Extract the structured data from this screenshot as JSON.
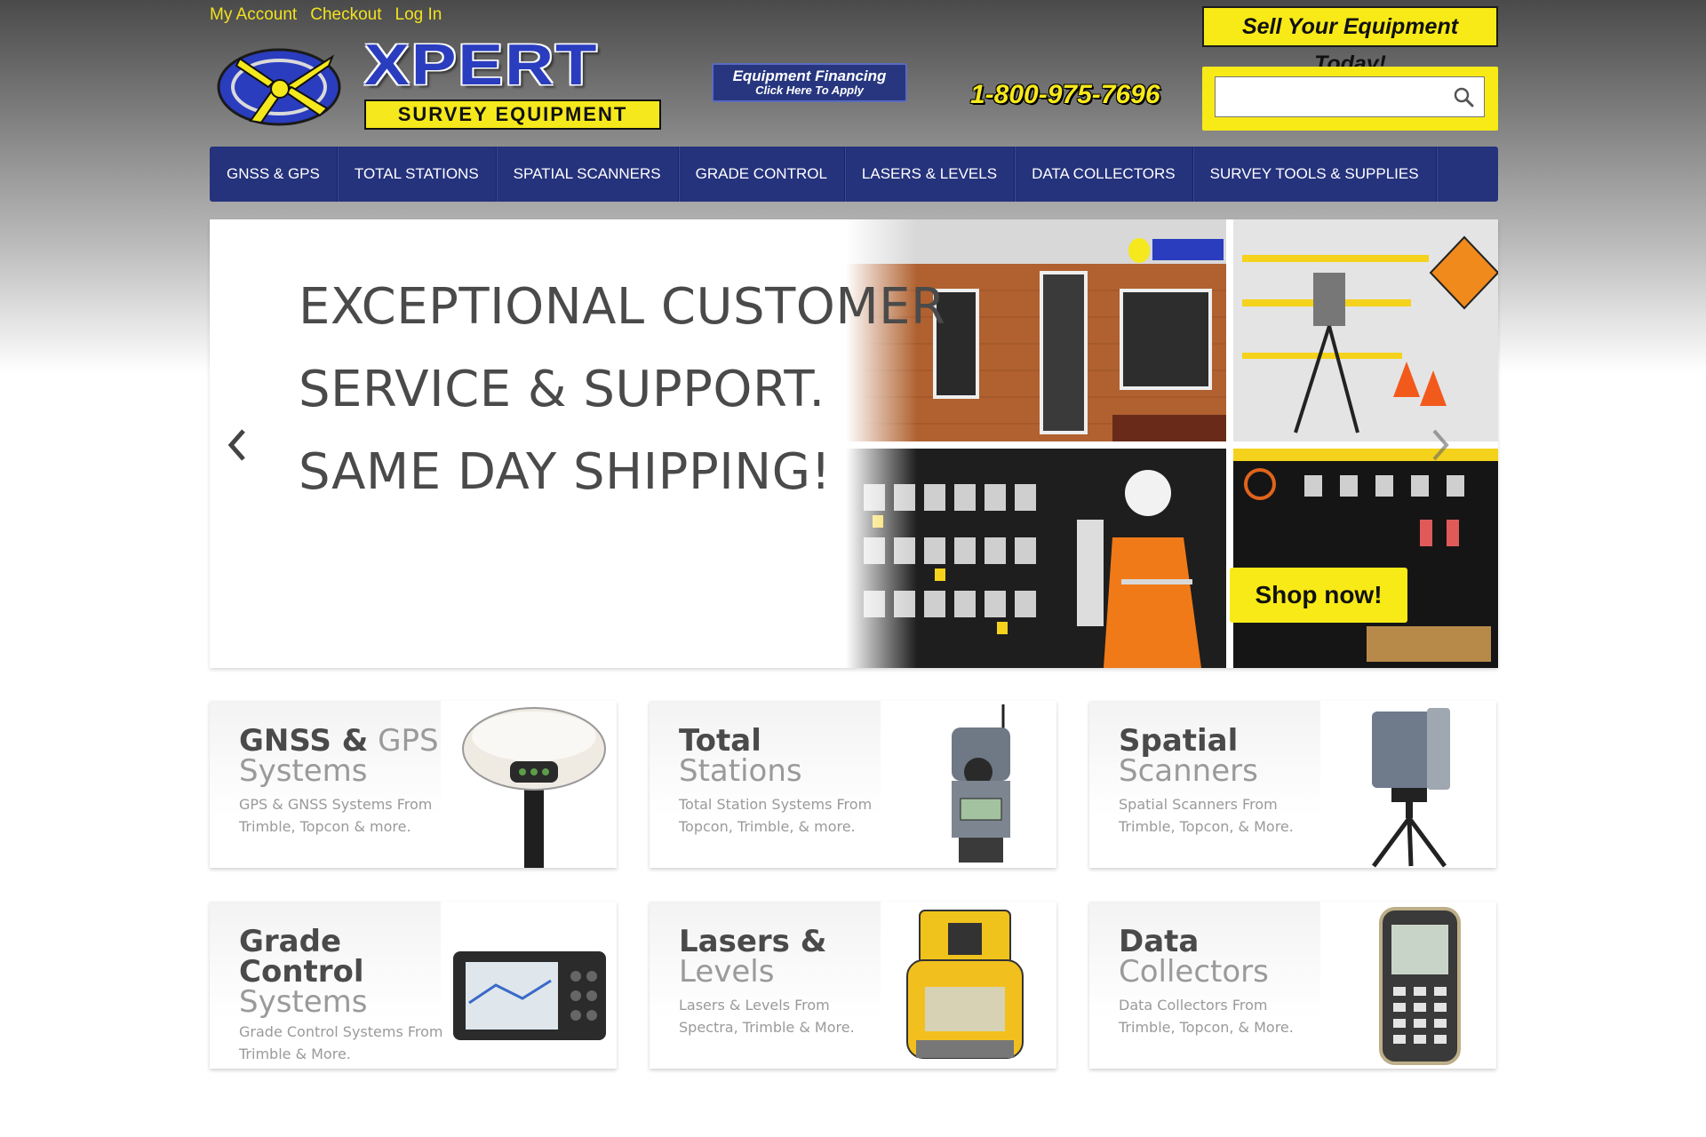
{
  "top_links": [
    "My Account",
    "Checkout",
    "Log In"
  ],
  "logo": {
    "word": "XPERT",
    "sub": "SURVEY EQUIPMENT"
  },
  "financing": {
    "line1": "Equipment Financing",
    "line2": "Click Here To Apply"
  },
  "phone": "1-800-975-7696",
  "sell_banner": "Sell Your Equipment Today!",
  "search": {
    "placeholder": ""
  },
  "nav": [
    "GNSS & GPS",
    "TOTAL STATIONS",
    "SPATIAL SCANNERS",
    "GRADE CONTROL",
    "LASERS & LEVELS",
    "DATA COLLECTORS",
    "SURVEY TOOLS & SUPPLIES"
  ],
  "hero": {
    "lines": [
      "EXCEPTIONAL CUSTOMER",
      "SERVICE & SUPPORT.",
      "SAME DAY SHIPPING!"
    ],
    "cta": "Shop now!"
  },
  "cards": [
    {
      "t1": "GNSS &",
      "t2": "GPS Systems",
      "desc": "GPS & GNSS Systems From Trimble, Topcon & more."
    },
    {
      "t1": "Total",
      "t2": "Stations",
      "desc": "Total Station Systems From Topcon, Trimble, & more."
    },
    {
      "t1": "Spatial",
      "t2": "Scanners",
      "desc": "Spatial Scanners From Trimble, Topcon, & More."
    },
    {
      "t1": "Grade Control",
      "t2": "Systems",
      "desc": "Grade Control Systems From Trimble & More."
    },
    {
      "t1": "Lasers &",
      "t2": "Levels",
      "desc": "Lasers & Levels From Spectra, Trimble & More."
    },
    {
      "t1": "Data",
      "t2": "Collectors",
      "desc": "Data Collectors From Trimble, Topcon, & More."
    }
  ],
  "colors": {
    "navy": "#25327c",
    "yellow": "#f8ea16",
    "logo_blue": "#2a3dbf"
  }
}
